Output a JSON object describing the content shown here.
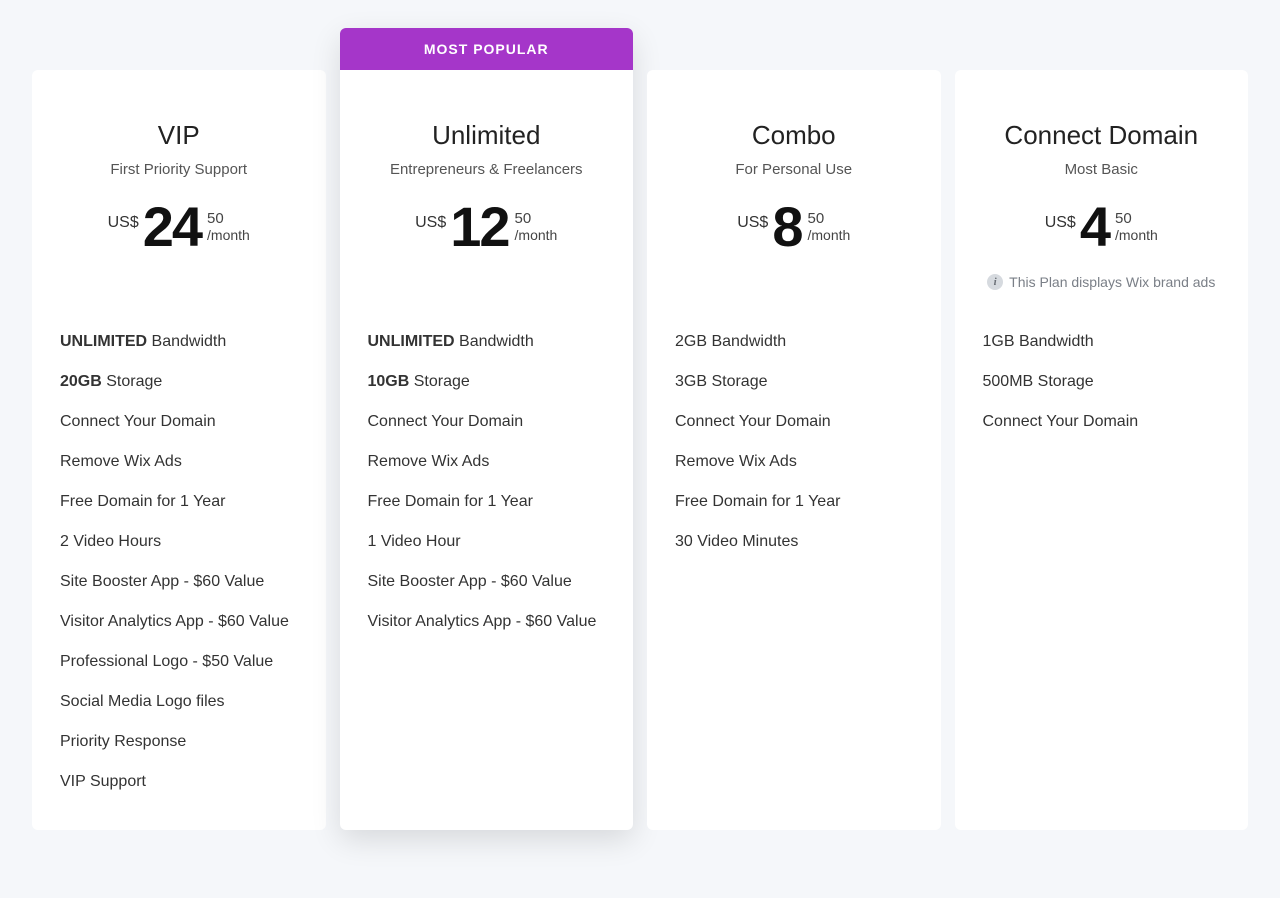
{
  "popular_banner": "MOST POPULAR",
  "plans": [
    {
      "id": "vip",
      "title": "VIP",
      "subtitle": "First Priority Support",
      "currency": "US$",
      "amount": "24",
      "cents": "50",
      "per": "/month",
      "note": null,
      "features": [
        {
          "bold": "UNLIMITED",
          "rest": " Bandwidth"
        },
        {
          "bold": "20GB",
          "rest": " Storage"
        },
        {
          "text": "Connect Your Domain"
        },
        {
          "text": "Remove Wix Ads"
        },
        {
          "text": "Free Domain for 1 Year"
        },
        {
          "text": "2 Video Hours"
        },
        {
          "text": "Site Booster App - $60 Value"
        },
        {
          "text": "Visitor Analytics App - $60 Value"
        },
        {
          "text": "Professional Logo - $50 Value"
        },
        {
          "text": "Social Media Logo files"
        },
        {
          "text": "Priority Response"
        },
        {
          "text": "VIP Support"
        }
      ]
    },
    {
      "id": "unlimited",
      "title": "Unlimited",
      "subtitle": "Entrepreneurs & Freelancers",
      "currency": "US$",
      "amount": "12",
      "cents": "50",
      "per": "/month",
      "note": null,
      "popular": true,
      "features": [
        {
          "bold": "UNLIMITED",
          "rest": " Bandwidth"
        },
        {
          "bold": "10GB",
          "rest": " Storage"
        },
        {
          "text": "Connect Your Domain"
        },
        {
          "text": "Remove Wix Ads"
        },
        {
          "text": "Free Domain for 1 Year"
        },
        {
          "text": "1 Video Hour"
        },
        {
          "text": "Site Booster App - $60 Value"
        },
        {
          "text": "Visitor Analytics App - $60 Value"
        }
      ]
    },
    {
      "id": "combo",
      "title": "Combo",
      "subtitle": "For Personal Use",
      "currency": "US$",
      "amount": "8",
      "cents": "50",
      "per": "/month",
      "note": null,
      "features": [
        {
          "text": "2GB Bandwidth"
        },
        {
          "text": "3GB Storage"
        },
        {
          "text": "Connect Your Domain"
        },
        {
          "text": "Remove Wix Ads"
        },
        {
          "text": "Free Domain for 1 Year"
        },
        {
          "text": "30 Video Minutes"
        }
      ]
    },
    {
      "id": "connect",
      "title": "Connect Domain",
      "subtitle": "Most Basic",
      "currency": "US$",
      "amount": "4",
      "cents": "50",
      "per": "/month",
      "note": "This Plan displays Wix brand ads",
      "features": [
        {
          "text": "1GB Bandwidth"
        },
        {
          "text": "500MB Storage"
        },
        {
          "text": "Connect Your Domain"
        }
      ]
    }
  ]
}
